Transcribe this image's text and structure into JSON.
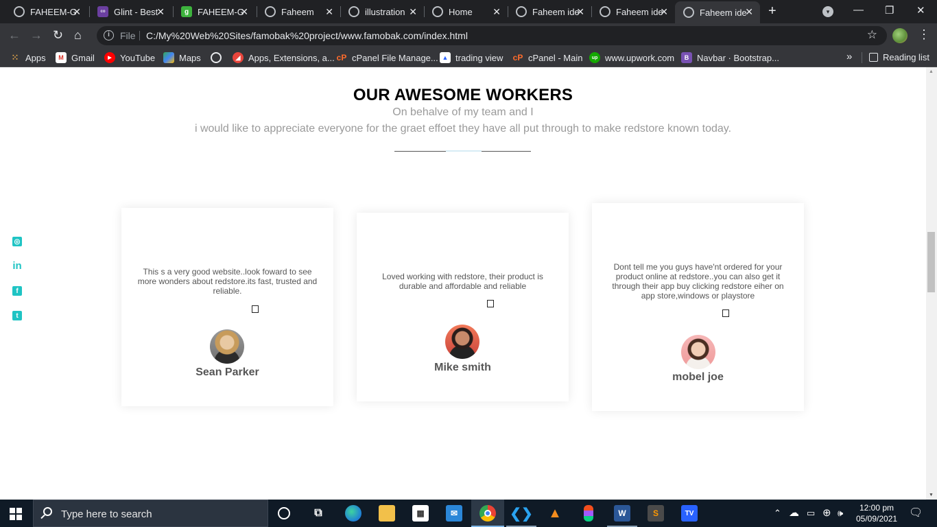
{
  "browser": {
    "tabs": [
      {
        "title": "FAHEEM-G",
        "favicon": "globe-icon"
      },
      {
        "title": "Glint - Best",
        "favicon": "coolors-icon"
      },
      {
        "title": "FAHEEM-G",
        "favicon": "g-icon"
      },
      {
        "title": "Faheem",
        "favicon": "globe-icon"
      },
      {
        "title": "illustration",
        "favicon": "globe-icon"
      },
      {
        "title": "Home",
        "favicon": "globe-icon"
      },
      {
        "title": "Faheem ide",
        "favicon": "globe-icon"
      },
      {
        "title": "Faheem ide",
        "favicon": "globe-icon"
      },
      {
        "title": "Faheem ide",
        "favicon": "globe-icon",
        "active": true
      }
    ],
    "file_label": "File",
    "url": "C:/My%20Web%20Sites/famobak%20project/www.famobak.com/index.html",
    "bookmarks": [
      {
        "label": "Apps",
        "icon": "apps-grid-icon"
      },
      {
        "label": "Gmail",
        "icon": "gmail-icon"
      },
      {
        "label": "YouTube",
        "icon": "youtube-icon"
      },
      {
        "label": "Maps",
        "icon": "maps-icon"
      },
      {
        "label": "",
        "icon": "globe-icon"
      },
      {
        "label": "Apps, Extensions, a...",
        "icon": "extensions-icon"
      },
      {
        "label": "cPanel File Manage...",
        "icon": "cpanel-icon"
      },
      {
        "label": "trading view",
        "icon": "tradingview-icon"
      },
      {
        "label": "cPanel - Main",
        "icon": "cpanel-icon"
      },
      {
        "label": "www.upwork.com",
        "icon": "upwork-icon"
      },
      {
        "label": "Navbar · Bootstrap...",
        "icon": "bootstrap-icon"
      }
    ],
    "more_label": "»",
    "reading_list": "Reading list"
  },
  "section": {
    "title": "OUR AWESOME WORKERS",
    "subtitle_line1": "On behalve of my team and I",
    "subtitle_line2": "i would like to appreciate everyone for the graet effoet they have all put through to make redstore known today."
  },
  "social": [
    "instagram-icon",
    "linkedin-icon",
    "facebook-icon",
    "twitter-icon"
  ],
  "testimonials": [
    {
      "quote": "This s a very good website..look foward to see more wonders about redstore.its fast, trusted and reliable.",
      "name": "Sean Parker"
    },
    {
      "quote": "Loved working with redstore, their product is durable and affordable and reliable",
      "name": "Mike smith"
    },
    {
      "quote": "Dont tell me you guys have'nt ordered for your product online at redstore..you can also get it through their app buy clicking redstore eiher on app store,windows or playstore",
      "name": "mobel joe"
    }
  ],
  "taskbar": {
    "search_placeholder": "Type here to search",
    "time": "12:00 pm",
    "date": "05/09/2021"
  },
  "colors": {
    "accent": "#1fc4c4",
    "title": "#000000",
    "subtitle": "#9a9a9a",
    "name": "#555555"
  }
}
